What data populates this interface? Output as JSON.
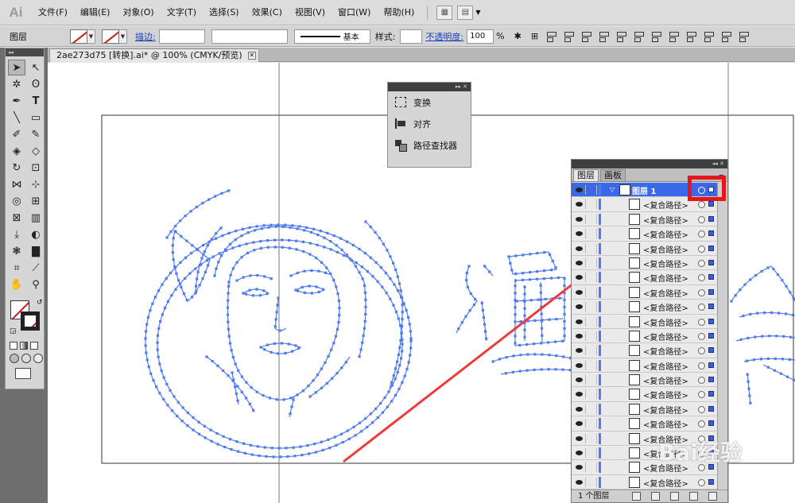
{
  "app": {
    "logo": "Ai",
    "menu": [
      "文件(F)",
      "编辑(E)",
      "对象(O)",
      "文字(T)",
      "选择(S)",
      "效果(C)",
      "视图(V)",
      "窗口(W)",
      "帮助(H)"
    ]
  },
  "controlbar": {
    "selection_label": "图层",
    "stroke_label": "描边:",
    "stroke_profile": "基本",
    "style_label": "样式:",
    "opacity_label": "不透明度:",
    "opacity_value": "100",
    "opacity_unit": "%"
  },
  "document": {
    "tab_title": "2ae273d75 [转换].ai* @ 100% (CMYK/预览)",
    "tab_close": "✕"
  },
  "mini_panel": {
    "items": [
      {
        "label": "变换",
        "icon": "transform-icon"
      },
      {
        "label": "对齐",
        "icon": "align-icon"
      },
      {
        "label": "路径查找器",
        "icon": "pathfinder-icon"
      }
    ]
  },
  "layers_panel": {
    "tabs": [
      "图层",
      "画板"
    ],
    "top_layer": "图层 1",
    "rows": [
      "<复合路径>",
      "<复合路径>",
      "<复合路径>",
      "<复合路径>",
      "<复合路径>",
      "<复合路径>",
      "<复合路径>",
      "<复合路径>",
      "<复合路径>",
      "<复合路径>",
      "<复合路径>",
      "<复合路径>",
      "<复合路径>",
      "<复合路径>",
      "<复合路径>",
      "<复合路径>",
      "<复合路径>",
      "<复合路径>",
      "<复合路径>",
      "<复合路径>"
    ],
    "footer_count": "1 个图层"
  },
  "watermark": "Bai经验",
  "colors": {
    "path_blue": "#4f7bf0",
    "highlight_red": "#e8141a",
    "layer_selected": "#3a68e8"
  }
}
